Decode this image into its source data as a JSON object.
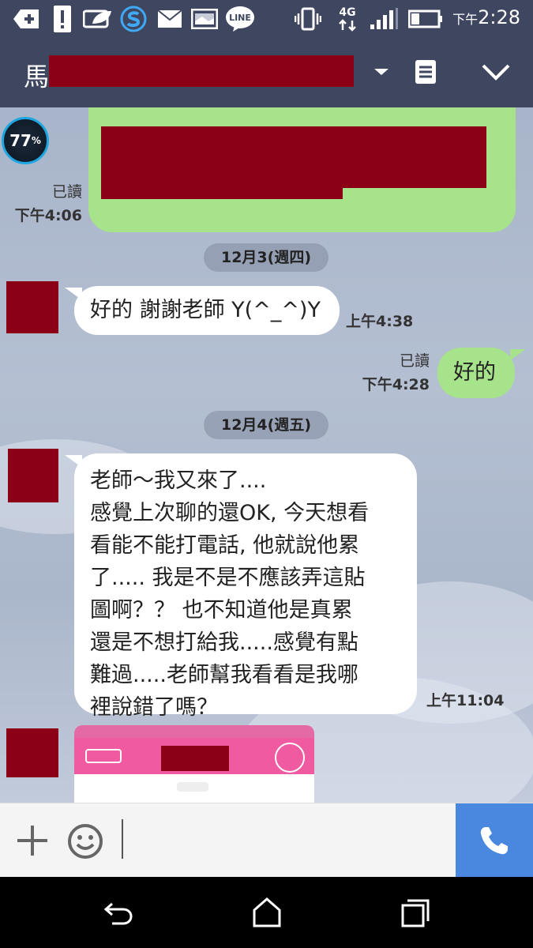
{
  "status": {
    "time_prefix": "下午",
    "time": "2:28",
    "network": "4G",
    "line_label": "LINE"
  },
  "header": {
    "contact_name": "馬"
  },
  "badge": {
    "percent": "77",
    "unit": "%"
  },
  "messages": [
    {
      "id": "m1",
      "read_label": "已讀",
      "time": "下午4:06"
    },
    {
      "id": "date1",
      "date": "12月3(週四)"
    },
    {
      "id": "m2",
      "text": "好的 謝謝老師 Y(^_^)Y",
      "time": "上午4:38"
    },
    {
      "id": "m3",
      "text": "好的",
      "read_label": "已讀",
      "time": "下午4:28"
    },
    {
      "id": "date2",
      "date": "12月4(週五)"
    },
    {
      "id": "m4",
      "lines": [
        "老師～我又來了....",
        "感覺上次聊的還OK, 今天想看",
        "看能不能打電話, 他就說他累",
        "了..... 我是不是不應該弄這貼",
        "圖啊？？ 也不知道他是真累",
        "還是不想打給我.....感覺有點",
        "難過.....老師幫我看看是我哪",
        "裡說錯了嗎？"
      ],
      "time": "上午11:04"
    }
  ],
  "colors": {
    "header_bg": "#3f4660",
    "outgoing_bubble": "#a6e38a",
    "incoming_bubble": "#ffffff",
    "call_button": "#4a88e0",
    "redaction": "#8b0016"
  }
}
